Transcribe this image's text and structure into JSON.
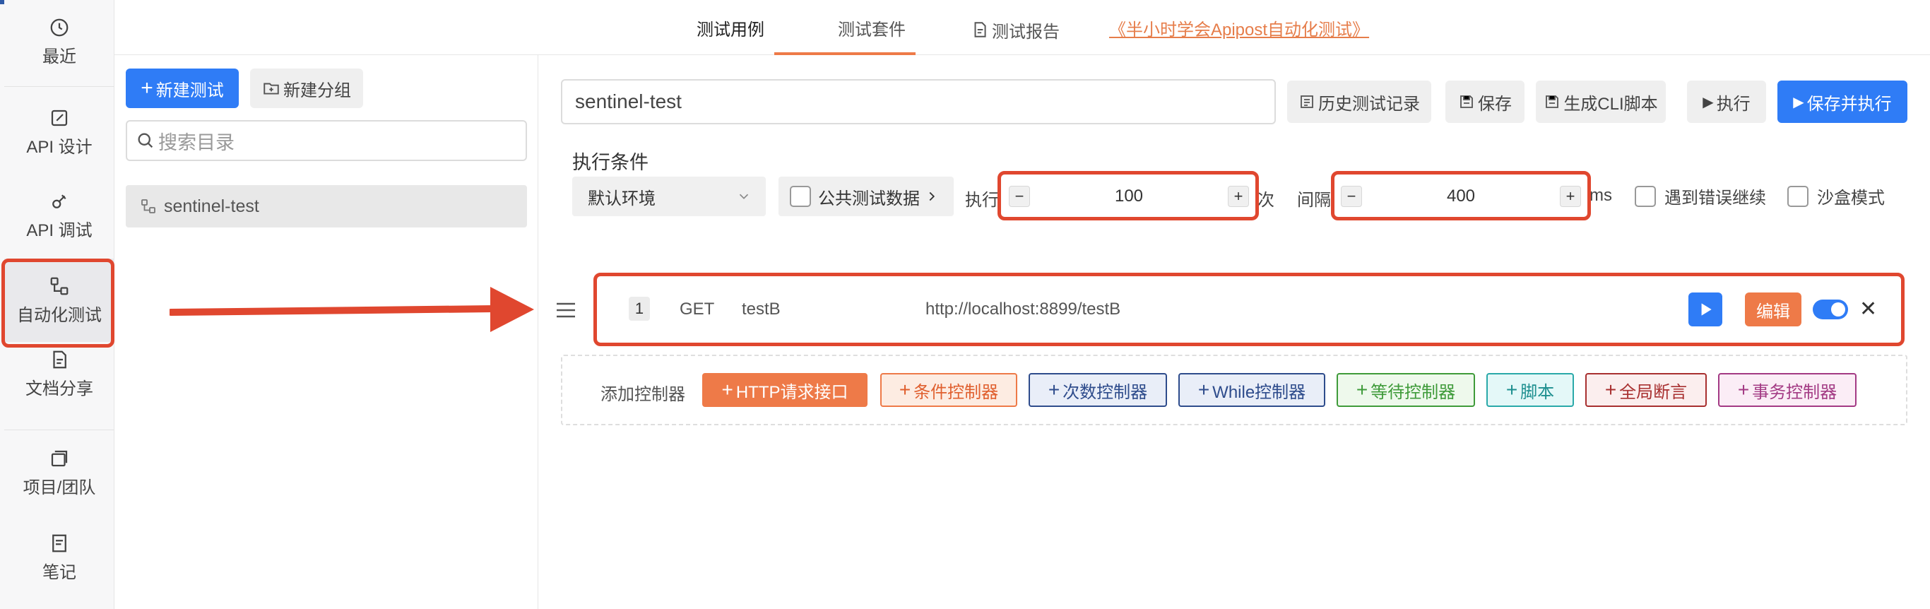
{
  "nav": {
    "items": [
      {
        "label": "最近",
        "icon": "clock-icon"
      },
      {
        "label": "API 设计",
        "icon": "edit-icon"
      },
      {
        "label": "API 调试",
        "icon": "bug-icon"
      },
      {
        "label": "自动化测试",
        "icon": "flow-icon"
      },
      {
        "label": "文档分享",
        "icon": "doc-share-icon"
      },
      {
        "label": "项目/团队",
        "icon": "project-icon"
      },
      {
        "label": "笔记",
        "icon": "note-icon"
      }
    ]
  },
  "tabs": {
    "items": [
      "测试用例",
      "测试套件",
      "测试报告"
    ],
    "link": "《半小时学会Apipost自动化测试》"
  },
  "tree": {
    "new_test": "新建测试",
    "new_group": "新建分组",
    "search_placeholder": "搜索目录",
    "item": "sentinel-test"
  },
  "toolbar": {
    "test_name": "sentinel-test",
    "history": "历史测试记录",
    "save": "保存",
    "cli": "生成CLI脚本",
    "run": "执行",
    "save_run": "保存并执行"
  },
  "conditions": {
    "title": "执行条件",
    "env": "默认环境",
    "public_data": "公共测试数据",
    "exec_label": "执行",
    "times": "100",
    "times_unit": "次",
    "interval_label": "间隔",
    "interval": "400",
    "interval_unit": "ms",
    "continue_on_error": "遇到错误继续",
    "sandbox": "沙盒模式"
  },
  "step": {
    "index": "1",
    "method": "GET",
    "name": "testB",
    "url": "http://localhost:8899/testB",
    "edit": "编辑"
  },
  "controllers": {
    "label": "添加控制器",
    "items": [
      "HTTP请求接口",
      "条件控制器",
      "次数控制器",
      "While控制器",
      "等待控制器",
      "脚本",
      "全局断言",
      "事务控制器"
    ]
  },
  "colors": {
    "accent": "#2f7cf6",
    "highlight": "#e0472f",
    "orange": "#ee7a48"
  }
}
